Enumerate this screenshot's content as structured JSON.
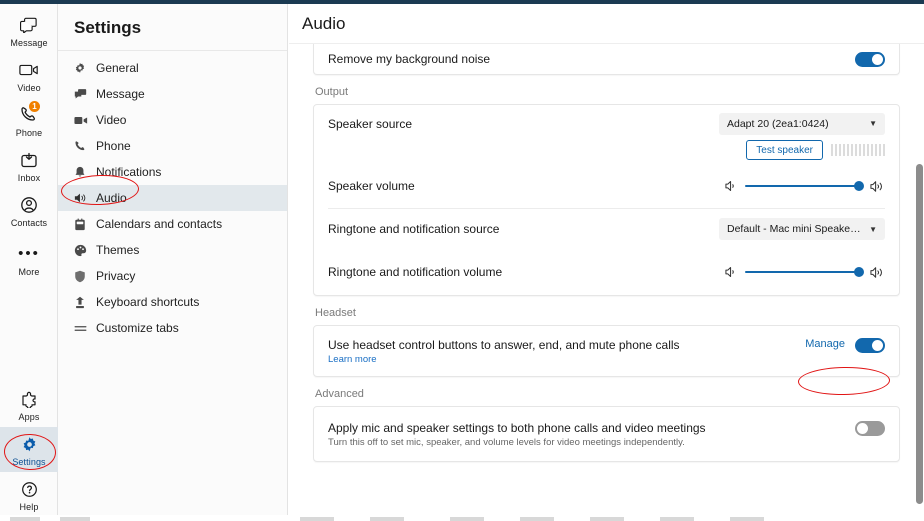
{
  "app_rail": {
    "items": [
      {
        "label": "Message",
        "icon": "message-icon",
        "badge": null,
        "active": false
      },
      {
        "label": "Video",
        "icon": "video-icon",
        "badge": null,
        "active": false
      },
      {
        "label": "Phone",
        "icon": "phone-icon",
        "badge": "1",
        "active": false
      },
      {
        "label": "Inbox",
        "icon": "inbox-icon",
        "badge": null,
        "active": false
      },
      {
        "label": "Contacts",
        "icon": "contacts-icon",
        "badge": null,
        "active": false
      },
      {
        "label": "More",
        "icon": "more-dots-icon",
        "badge": null,
        "active": false
      }
    ],
    "bottom_items": [
      {
        "label": "Apps",
        "icon": "apps-puzzle-icon",
        "active": false
      },
      {
        "label": "Settings",
        "icon": "gear-icon",
        "active": true
      },
      {
        "label": "Help",
        "icon": "help-question-icon",
        "active": false
      }
    ]
  },
  "settings_panel": {
    "title": "Settings",
    "items": [
      {
        "label": "General",
        "icon": "gear-icon",
        "active": false
      },
      {
        "label": "Message",
        "icon": "message-icon",
        "active": false
      },
      {
        "label": "Video",
        "icon": "video-camera-icon",
        "active": false
      },
      {
        "label": "Phone",
        "icon": "phone-handset-icon",
        "active": false
      },
      {
        "label": "Notifications",
        "icon": "bell-icon",
        "active": false
      },
      {
        "label": "Audio",
        "icon": "speaker-icon",
        "active": true
      },
      {
        "label": "Calendars and contacts",
        "icon": "calendar-icon",
        "active": false
      },
      {
        "label": "Themes",
        "icon": "palette-icon",
        "active": false
      },
      {
        "label": "Privacy",
        "icon": "shield-icon",
        "active": false
      },
      {
        "label": "Keyboard shortcuts",
        "icon": "keyboard-icon",
        "active": false
      },
      {
        "label": "Customize tabs",
        "icon": "list-lines-icon",
        "active": false
      }
    ]
  },
  "main": {
    "header_title": "Audio",
    "noise_row": {
      "label": "Remove my background noise",
      "toggle_state": "on"
    },
    "output": {
      "section_label": "Output",
      "speaker_source": {
        "label": "Speaker source",
        "value": "Adapt 20 (2ea1:0424)",
        "caret": "▼"
      },
      "test_speaker_button": "Test speaker",
      "speaker_volume": {
        "label": "Speaker volume",
        "value": 100
      },
      "ringtone_source": {
        "label": "Ringtone and notification source",
        "value": "Default - Mac mini Speakers (B...",
        "caret": "▼"
      },
      "ringtone_volume": {
        "label": "Ringtone and notification volume",
        "value": 100
      }
    },
    "headset": {
      "section_label": "Headset",
      "label": "Use headset control buttons to answer, end, and mute phone calls",
      "learn_more": "Learn more",
      "manage_label": "Manage",
      "toggle_state": "on"
    },
    "advanced": {
      "section_label": "Advanced",
      "label": "Apply mic and speaker settings to both phone calls and video meetings",
      "sublabel": "Turn this off to set mic, speaker, and volume levels for video meetings independently.",
      "toggle_state": "off"
    }
  },
  "colors": {
    "accent": "#1268ad",
    "topbar": "#1b3a52",
    "badge": "#f08000",
    "annotation": "#e11515",
    "active_nav": "#e2e8ec"
  }
}
